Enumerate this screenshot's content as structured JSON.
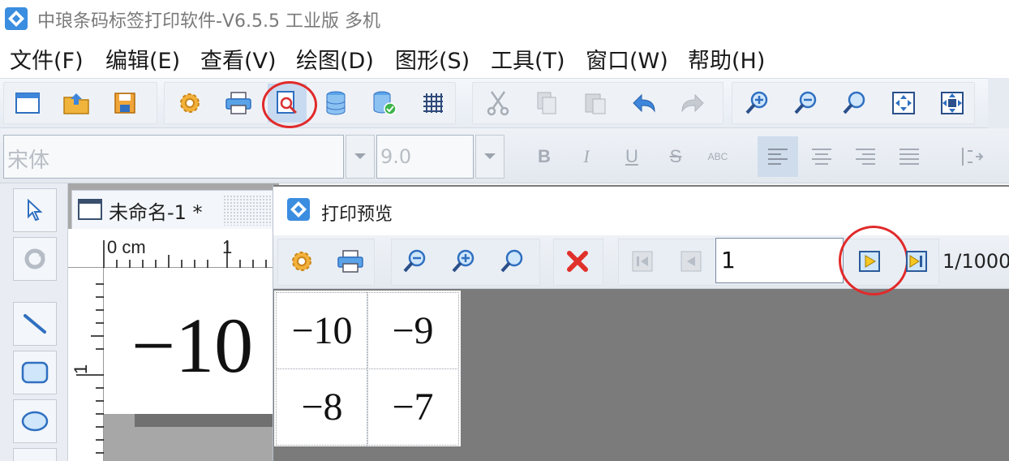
{
  "window": {
    "title": "中琅条码标签打印软件-V6.5.5 工业版 多机"
  },
  "menu": [
    {
      "id": "file",
      "label": "文件(F)"
    },
    {
      "id": "edit",
      "label": "编辑(E)"
    },
    {
      "id": "view",
      "label": "查看(V)"
    },
    {
      "id": "draw",
      "label": "绘图(D)"
    },
    {
      "id": "shape",
      "label": "图形(S)"
    },
    {
      "id": "tools",
      "label": "工具(T)"
    },
    {
      "id": "window",
      "label": "窗口(W)"
    },
    {
      "id": "help",
      "label": "帮助(H)"
    }
  ],
  "toolbar": {
    "buttons": [
      "new-doc-icon",
      "open-folder-icon",
      "save-disk-icon",
      "settings-gear-icon",
      "printer-icon",
      "print-preview-icon",
      "database-icon",
      "database-connect-icon",
      "grid-icon",
      "cut-icon",
      "copy-icon",
      "paste-icon",
      "undo-icon",
      "redo-icon",
      "zoom-in-icon",
      "zoom-out-icon",
      "zoom-fit-icon",
      "fit-window-icon",
      "fit-page-icon"
    ]
  },
  "format_bar": {
    "font_name": "宋体",
    "font_size": "9.0",
    "bold_label": "B",
    "italic_label": "I",
    "underline_label": "U",
    "strike_label": "S",
    "outline_label": "ABC"
  },
  "document": {
    "tab_title": "未命名-1 *",
    "ruler_unit": "0 cm",
    "ruler_mark_h": "1",
    "ruler_mark_v": "1",
    "canvas_value": "−10"
  },
  "preview": {
    "title": "打印预览",
    "current_page": "1",
    "page_total": "1/1000",
    "labels": [
      "−10",
      "−9",
      "−8",
      "−7"
    ]
  },
  "colors": {
    "highlight_ring": "#e12a2a",
    "accent_blue": "#2f7fd8"
  }
}
